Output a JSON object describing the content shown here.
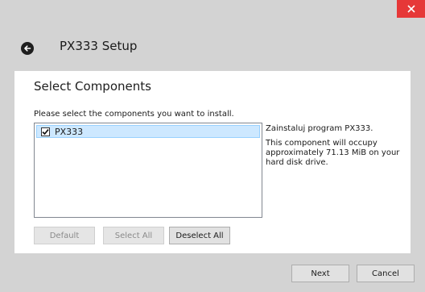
{
  "window": {
    "title": "PX333 Setup"
  },
  "page": {
    "heading": "Select Components",
    "instruction": "Please select the components you want to install."
  },
  "components": [
    {
      "label": "PX333",
      "checked": true
    }
  ],
  "description": {
    "line1": "Zainstaluj program PX333.",
    "line2": "This component will occupy approximately 71.13 MiB on your hard disk drive."
  },
  "selection_buttons": {
    "default": "Default",
    "select_all": "Select All",
    "deselect_all": "Deselect All"
  },
  "footer": {
    "next": "Next",
    "cancel": "Cancel"
  },
  "colors": {
    "close_button": "#e63838",
    "selection_highlight": "#cde8ff"
  }
}
